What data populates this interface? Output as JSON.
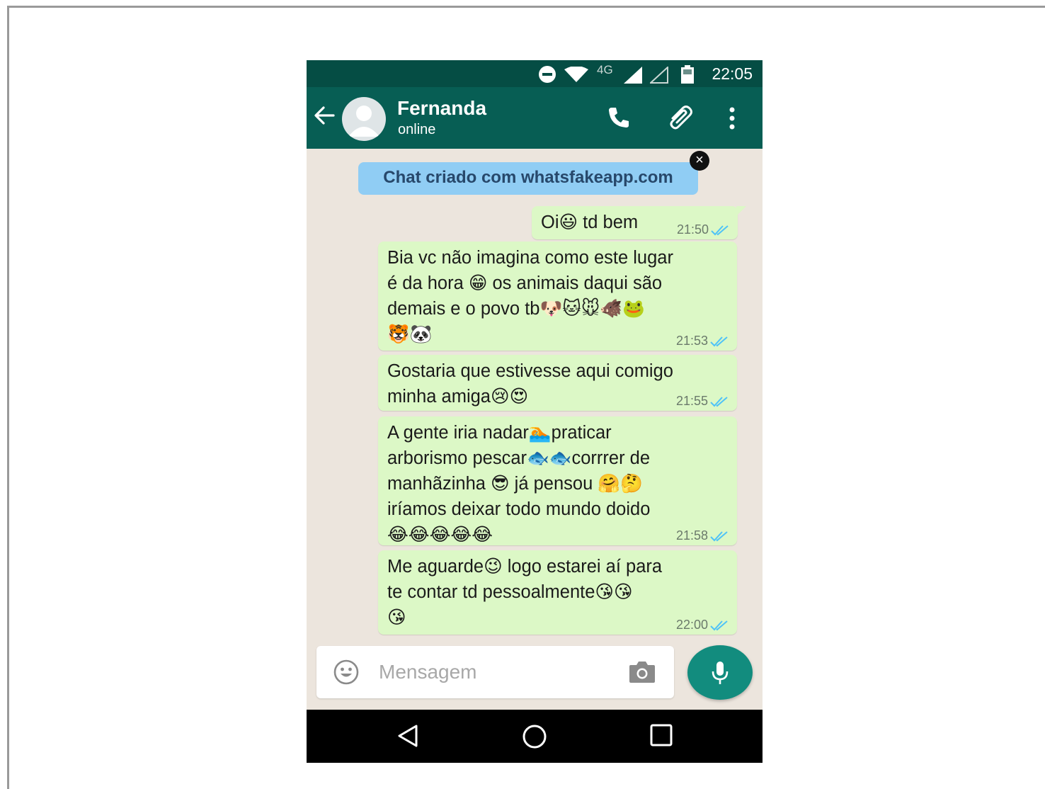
{
  "status_bar": {
    "network": "4G",
    "time": "22:05",
    "icons": [
      "do-not-disturb-icon",
      "wifi-icon",
      "signal-icon",
      "signal-empty-icon",
      "battery-icon"
    ]
  },
  "header": {
    "contact_name": "Fernanda",
    "contact_status": "online",
    "icons": [
      "back-arrow-icon",
      "avatar-placeholder-icon",
      "phone-icon",
      "paperclip-icon",
      "more-vertical-icon"
    ]
  },
  "banner": {
    "text": "Chat criado com whatsfakeapp.com",
    "close_symbol": "×"
  },
  "messages": [
    {
      "text": "Oi😃 td bem",
      "time": "21:50"
    },
    {
      "text": "Bia vc não imagina como este lugar\né da hora 😁 os animais daqui são\ndemais e o povo tb🐶🐱🐭🐗🐸\n🐯🐼",
      "time": "21:53"
    },
    {
      "text": "Gostaria que estivesse aqui comigo\nminha amiga😢😍",
      "time": "21:55"
    },
    {
      "text": "A gente iria nadar🏊praticar\narborismo pescar🐟🐟corrrer de\nmanhãzinha 😎 já pensou 🤗🤔\niríamos deixar todo mundo doido\n😂😂😂😂😂",
      "time": "21:58"
    },
    {
      "text": "Me aguarde😉 logo estarei aí para\nte contar td pessoalmente😘😘\n😘",
      "time": "22:00"
    }
  ],
  "colors": {
    "header": "#075e54",
    "status_bar": "#054d44",
    "outgoing_bubble": "#dcf8c6",
    "chat_background": "#ece5dd",
    "read_ticks": "#4fc3f7",
    "mic_button": "#128c7e"
  },
  "composer": {
    "placeholder": "Mensagem",
    "icons": [
      "emoji-icon",
      "camera-icon",
      "microphone-icon"
    ]
  },
  "nav_bar": {
    "icons": [
      "back-triangle-icon",
      "home-circle-icon",
      "recents-square-icon"
    ]
  }
}
